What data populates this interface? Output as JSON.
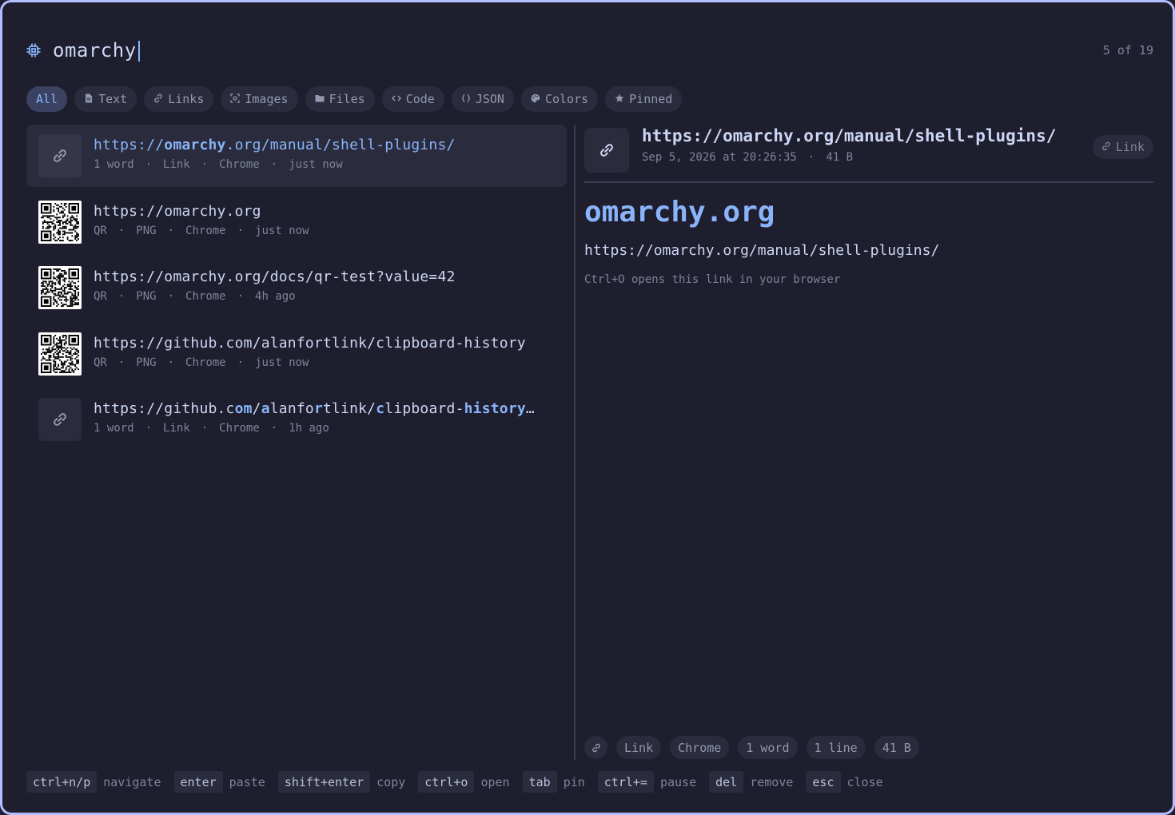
{
  "search": {
    "query": "omarchy",
    "counter": "5 of 19"
  },
  "filters": [
    {
      "label": "All",
      "icon": "none",
      "active": true
    },
    {
      "label": "Text",
      "icon": "document-icon"
    },
    {
      "label": "Links",
      "icon": "link-icon"
    },
    {
      "label": "Images",
      "icon": "image-icon"
    },
    {
      "label": "Files",
      "icon": "folder-icon"
    },
    {
      "label": "Code",
      "icon": "code-icon"
    },
    {
      "label": "JSON",
      "icon": "braces-icon"
    },
    {
      "label": "Colors",
      "icon": "palette-icon"
    },
    {
      "label": "Pinned",
      "icon": "star-icon"
    }
  ],
  "items": [
    {
      "title_parts": [
        "https://",
        "omarchy",
        ".org/manual/shell-plugins/"
      ],
      "meta": [
        "1 word",
        "Link",
        "Chrome",
        "just now"
      ],
      "kind": "link"
    },
    {
      "title": "https://omarchy.org",
      "meta": [
        "QR",
        "PNG",
        "Chrome",
        "just now"
      ],
      "kind": "qr"
    },
    {
      "title": "https://omarchy.org/docs/qr-test?value=42",
      "meta": [
        "QR",
        "PNG",
        "Chrome",
        "4h ago"
      ],
      "kind": "qr"
    },
    {
      "title": "https://github.com/alanfortlink/clipboard-history",
      "meta": [
        "QR",
        "PNG",
        "Chrome",
        "just now"
      ],
      "kind": "qr"
    },
    {
      "title_parts": [
        "https://github.c",
        "om",
        "/",
        "a",
        "lanfo",
        "r",
        "tlink/",
        "c",
        "lipboard-",
        "h",
        "istory",
        "…"
      ],
      "meta": [
        "1 word",
        "Link",
        "Chrome",
        "1h ago"
      ],
      "kind": "link"
    }
  ],
  "preview": {
    "title": "https://omarchy.org/manual/shell-plugins/",
    "date": "Sep 5, 2026 at 20:26:35",
    "size": "41 B",
    "badge": "Link",
    "domain_name": "omarchy",
    "domain_tld": ".org",
    "full_url": "https://omarchy.org/manual/shell-plugins/",
    "hint": "Ctrl+O opens this link in your browser",
    "tags": [
      "Link",
      "Chrome",
      "1 word",
      "1 line",
      "41 B"
    ]
  },
  "shortcuts": [
    {
      "key": "ctrl+n/p",
      "desc": "navigate"
    },
    {
      "key": "enter",
      "desc": "paste"
    },
    {
      "key": "shift+enter",
      "desc": "copy"
    },
    {
      "key": "ctrl+o",
      "desc": "open"
    },
    {
      "key": "tab",
      "desc": "pin"
    },
    {
      "key": "ctrl+=",
      "desc": "pause"
    },
    {
      "key": "del",
      "desc": "remove"
    },
    {
      "key": "esc",
      "desc": "close"
    }
  ],
  "colors": {
    "background": "#1e1e2e",
    "accent": "#89b4fa",
    "border": "#b4befe",
    "surface": "#2a2b3c",
    "muted": "#7f849c"
  }
}
